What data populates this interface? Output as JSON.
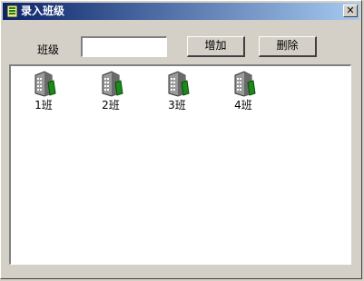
{
  "window": {
    "title": "录入班级",
    "close_glyph": "✕"
  },
  "form": {
    "class_label": "班级",
    "class_value": "",
    "add_label": "增加",
    "delete_label": "删除"
  },
  "list": {
    "items": [
      {
        "label": "1班",
        "icon": "building-icon"
      },
      {
        "label": "2班",
        "icon": "building-icon"
      },
      {
        "label": "3班",
        "icon": "building-icon"
      },
      {
        "label": "4班",
        "icon": "building-icon"
      }
    ]
  }
}
